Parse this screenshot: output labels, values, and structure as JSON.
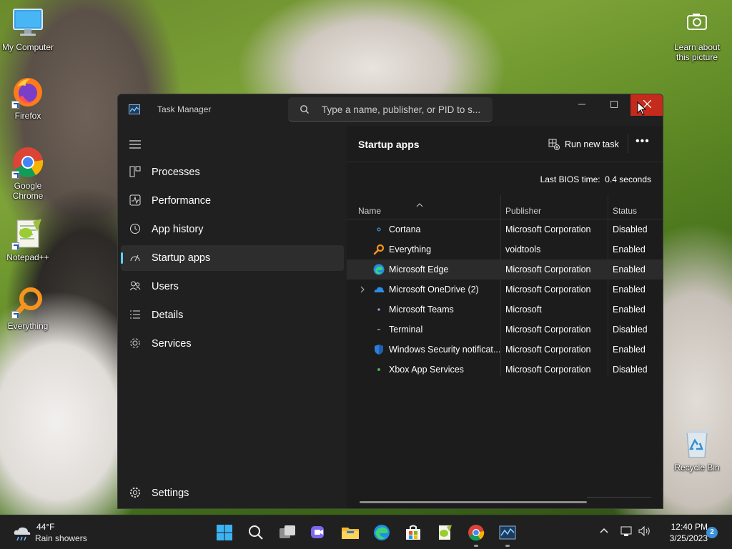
{
  "desktop": {
    "icons": [
      {
        "label": "My Computer",
        "icon": "monitor-icon"
      },
      {
        "label": "Firefox",
        "icon": "firefox-icon"
      },
      {
        "label": "Google Chrome",
        "icon": "chrome-icon"
      },
      {
        "label": "Notepad++",
        "icon": "notepadpp-icon"
      },
      {
        "label": "Everything",
        "icon": "everything-icon"
      }
    ],
    "right_icons": [
      {
        "label": "Learn about this picture",
        "icon": "camera-icon"
      },
      {
        "label": "Recycle Bin",
        "icon": "recycle-bin-icon"
      }
    ]
  },
  "window": {
    "title": "Task Manager",
    "search_placeholder": "Type a name, publisher, or PID to s..."
  },
  "sidebar": {
    "items": [
      {
        "label": "Processes",
        "icon": "processes-icon"
      },
      {
        "label": "Performance",
        "icon": "performance-icon"
      },
      {
        "label": "App history",
        "icon": "history-icon"
      },
      {
        "label": "Startup apps",
        "icon": "startup-icon",
        "active": true
      },
      {
        "label": "Users",
        "icon": "users-icon"
      },
      {
        "label": "Details",
        "icon": "details-icon"
      },
      {
        "label": "Services",
        "icon": "services-icon"
      }
    ],
    "settings_label": "Settings"
  },
  "content": {
    "title": "Startup apps",
    "run_task_label": "Run new task",
    "more_label": "•••",
    "bios_label": "Last BIOS time:",
    "bios_value": "0.4 seconds",
    "columns": [
      "Name",
      "Publisher",
      "Status"
    ],
    "rows": [
      {
        "name": "Cortana",
        "publisher": "Microsoft Corporation",
        "status": "Disabled"
      },
      {
        "name": "Everything",
        "publisher": "voidtools",
        "status": "Enabled"
      },
      {
        "name": "Microsoft Edge",
        "publisher": "Microsoft Corporation",
        "status": "Enabled",
        "selected": true
      },
      {
        "name": "Microsoft OneDrive (2)",
        "publisher": "Microsoft Corporation",
        "status": "Enabled",
        "expandable": true
      },
      {
        "name": "Microsoft Teams",
        "publisher": "Microsoft",
        "status": "Enabled"
      },
      {
        "name": "Terminal",
        "publisher": "Microsoft Corporation",
        "status": "Disabled"
      },
      {
        "name": "Windows Security notificat...",
        "publisher": "Microsoft Corporation",
        "status": "Enabled"
      },
      {
        "name": "Xbox App Services",
        "publisher": "Microsoft Corporation",
        "status": "Disabled"
      }
    ]
  },
  "taskbar": {
    "weather_temp": "44°F",
    "weather_desc": "Rain showers",
    "time": "12:40 PM",
    "date": "3/25/2023",
    "notification_count": "2",
    "colors": {
      "accent": "#60cdff",
      "close_red": "#c42b1c",
      "badge": "#3a8fd8"
    }
  }
}
